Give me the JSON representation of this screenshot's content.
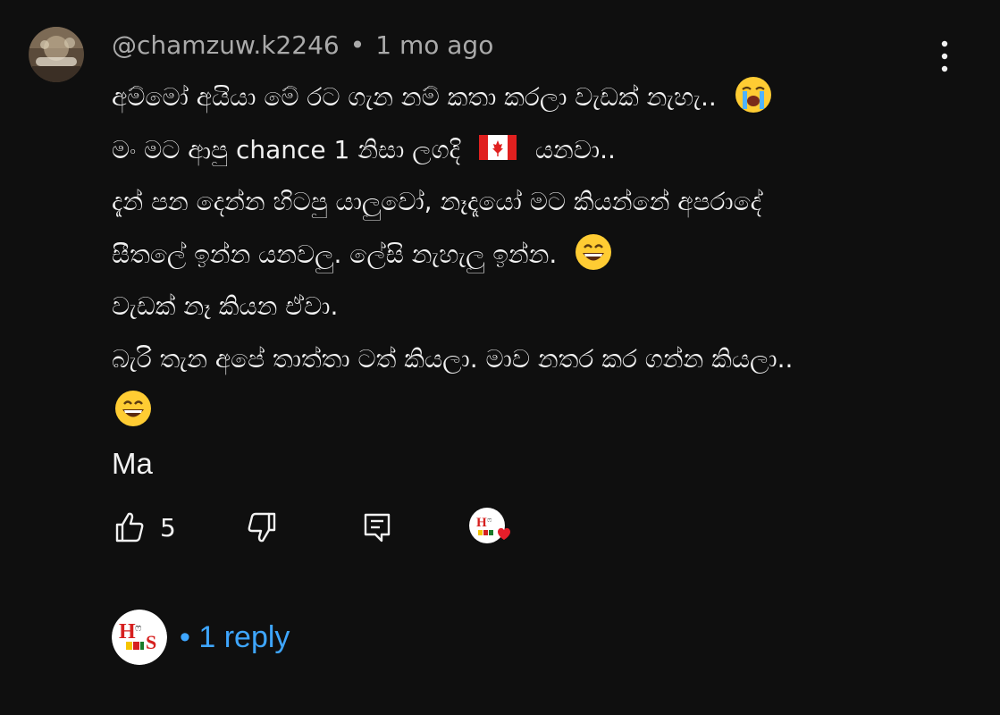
{
  "comment": {
    "author": "@chamzuw.k2246",
    "separator": "•",
    "time": "1 mo ago",
    "lines": [
      "අම්මෝ අයියා මේ රට ගැන නම් කතා කරලා වැඩක් නැහැ..",
      "මං මට ආපු chance 1 නිසා ලගදි",
      "යනවා..",
      "දැන් පන දෙන්න හිටපු යාලුවෝ, නෑදෑයෝ මට කියන්නේ අපරාදේ",
      "සීතලේ ඉන්න යනවලු. ලේසි නැහැලු ඉන්න.",
      "වැඩක් නෑ කියන ඒවා.",
      "බැරි තැන අපේ තාත්තා ටත් කියලා. මාව නතර කර ගන්න කියලා..",
      "Ma"
    ],
    "emojis": [
      "loudly-crying-face",
      "canada-flag",
      "grinning-face",
      "grinning-face"
    ]
  },
  "actions": {
    "like_count": "5",
    "icons": [
      "thumbs-up-icon",
      "thumbs-down-icon",
      "reply-icon",
      "creator-heart-icon"
    ]
  },
  "replies": {
    "label": "1 reply",
    "separator": "•",
    "color": "#3ea6ff"
  },
  "colors": {
    "background": "#0f0f0f",
    "text": "#f1f1f1",
    "meta": "#aaaaaa",
    "link": "#3ea6ff"
  }
}
